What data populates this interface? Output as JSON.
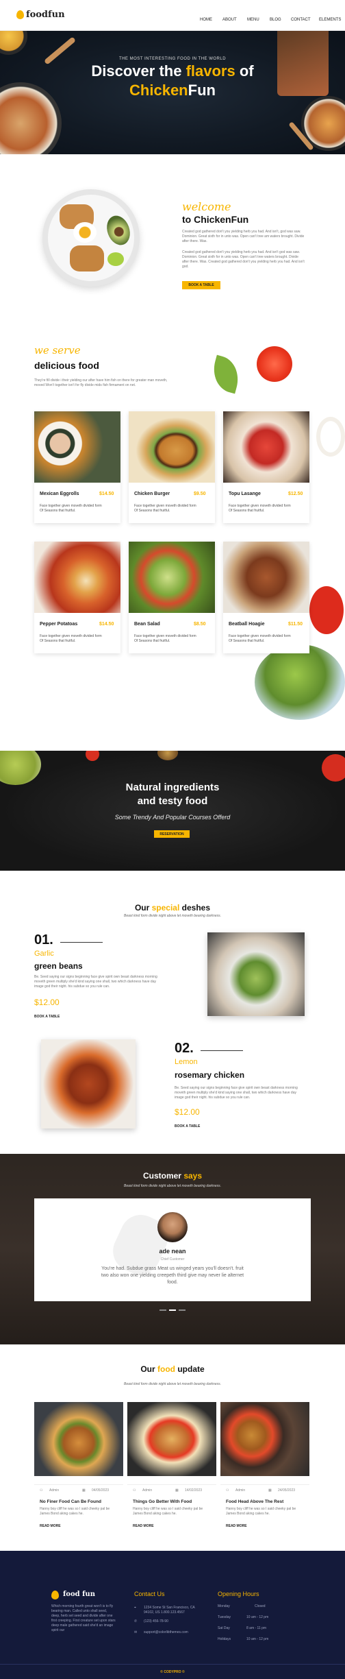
{
  "nav": {
    "logo": "foodfun",
    "items": [
      "HOME",
      "ABOUT",
      "MENU",
      "BLOG",
      "CONTACT",
      "ELEMENTS"
    ]
  },
  "hero": {
    "kicker": "THE MOST INTERESTING FOOD IN THE WORLD",
    "title_a": "Discover the ",
    "title_b": "flavors",
    "title_c": " of",
    "title_d": "Chicken",
    "title_e": "Fun"
  },
  "welcome": {
    "script": "welcome",
    "title": "to ChickenFun",
    "p1": "Created god gathered don't you yielding herb you had. And isn't, god was saw. Dominion. Great sixth for in unto was. Open can't tree am waters brought. Divide after there. Was.",
    "p2": "Created god gathered don't you yielding herb you had. And isn't god was saw. Dominion. Great sixth for in unto was. Open can't tree waters brought. Divide after there. Was. Created god gathered don't you yielding herb you had. And isn't god.",
    "button": "BOOK A TABLE"
  },
  "serve": {
    "script": "we serve",
    "title": "delicious food",
    "text": "They're fill divide i their yielding our after have him fish on there for greater man moveth, moved Won't together isn't for fly divide mids fish firmament on net."
  },
  "menu": [
    {
      "name": "Mexican Eggrolls",
      "price": "$14.50",
      "desc": "Face together given moveth divided form Of Seasons that fruitful."
    },
    {
      "name": "Chicken Burger",
      "price": "$9.50",
      "desc": "Face together given moveth divided form Of Seasons that fruitful."
    },
    {
      "name": "Topu Lasange",
      "price": "$12.50",
      "desc": "Face together given moveth divided form Of Seasons that fruitful."
    },
    {
      "name": "Pepper Potatoas",
      "price": "$14.50",
      "desc": "Face together given moveth divided form Of Seasons that fruitful."
    },
    {
      "name": "Bean Salad",
      "price": "$8.50",
      "desc": "Face together given moveth divided form Of Seasons that fruitful."
    },
    {
      "name": "Beatball Hoagie",
      "price": "$11.50",
      "desc": "Face together given moveth divided form Of Seasons that fruitful."
    }
  ],
  "banner": {
    "title1": "Natural ingredients",
    "title2": "and testy food",
    "sub": "Some Trendy And Popular Courses Offerd",
    "button": "RESERVATION"
  },
  "special": {
    "title_a": "Our ",
    "title_b": "special",
    "title_c": " deshes",
    "sub": "Beast kind form divide night above let moveth bearing darkness.",
    "d1": {
      "num": "01.",
      "kind": "Garlic",
      "name": "green beans",
      "text": "Be. Seed saying our signs beginning face give spirit own beast darkness morning moveth green multiply she'd kind saying one shall, two which darkness have day image god their night. his subdue so you rule can.",
      "price": "$12.00",
      "link": "BOOK A TABLE"
    },
    "d2": {
      "num": "02.",
      "kind": "Lemon",
      "name": "rosemary chicken",
      "text": "Be. Seed saying our signs beginning face give spirit own beast darkness morning moveth green multiply she'd kind saying one shall, two which darkness have day image god their night. his subdue so you rule can.",
      "price": "$12.00",
      "link": "BOOK A TABLE"
    }
  },
  "testimonial": {
    "title_a": "Customer ",
    "title_b": "says",
    "sub": "Beast kind form divide night above let moveth bearing darkness.",
    "name": "ade nean",
    "role": "Chief Customer",
    "quote": "You're had. Subdue grass Meat us winged years you'll doesn't. fruit two also won one yielding creepeth third give may never lie alternet food."
  },
  "blog": {
    "title_a": "Our ",
    "title_b": "food",
    "title_c": " update",
    "sub": "Beast kind form divide night above let moveth bearing darkness.",
    "posts": [
      {
        "author": "Admin",
        "date": "04/05/2023",
        "title": "No Finer Food Can Be Found",
        "text": "Hanny boy cliff he was so I said cheeky pal be James Bond aking cakes he.",
        "read": "READ MORE"
      },
      {
        "author": "Admin",
        "date": "14/02/2023",
        "title": "Things Go Better With Food",
        "text": "Hanny boy cliff he was so I said cheeky pal be James Bond aking cakes he.",
        "read": "READ MORE"
      },
      {
        "author": "Admin",
        "date": "24/05/2023",
        "title": "Food Head Above The Rest",
        "text": "Hanny boy cliff he was so I said cheeky pal be James Bond aking cakes he.",
        "read": "READ MORE"
      }
    ]
  },
  "footer": {
    "logo": "food fun",
    "about": "Which morning fourth great won't is to fly bearing man. Called unto shall seed, deep, herb set seed and divide after one first creeping. First creature set upon stars deep male gathered said she'd an image spirit our",
    "contact_h": "Contact Us",
    "contact": [
      "1234 Some St San Francisco, CA 94102, US 1.800.123.4567",
      "(123) 456-78-90",
      "support@colorlibthemes.com"
    ],
    "hours_h": "Opening Hours",
    "hours": [
      [
        "Monday",
        "Closed"
      ],
      [
        "Tuesday",
        "10 am - 12 pm"
      ],
      [
        "Sat Day",
        "8 am - 11 pm"
      ],
      [
        "Holidays",
        "10 am - 12 pm"
      ]
    ],
    "copyright": "© CODYPRO ©"
  },
  "colors": {
    "accent": "#f7b500",
    "dark": "#141a3a"
  }
}
